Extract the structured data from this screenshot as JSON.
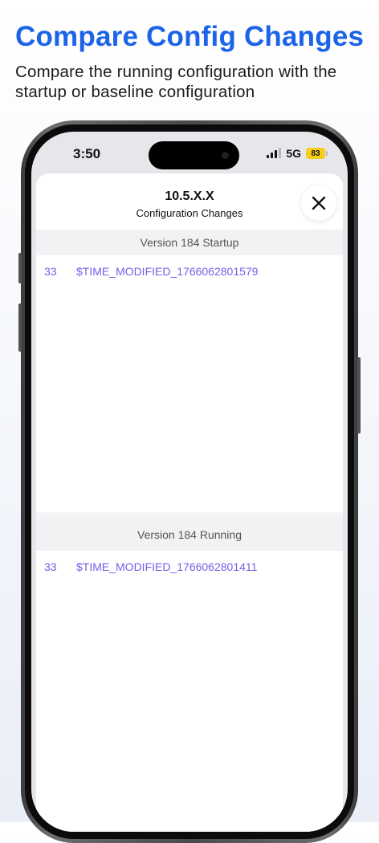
{
  "promo": {
    "title": "Compare Config Changes",
    "subtitle": "Compare the running configuration with the startup or baseline configuration"
  },
  "status_bar": {
    "time": "3:50",
    "network": "5G",
    "battery": "83",
    "signal_bars_active": 3,
    "signal_bars_total": 4,
    "battery_color": "#f7ce1c"
  },
  "sheet": {
    "title": "10.5.X.X",
    "subtitle": "Configuration Changes",
    "close_icon": "close-x-icon"
  },
  "panels": [
    {
      "header": "Version 184 Startup",
      "lines": [
        {
          "number": "33",
          "text": "$TIME_MODIFIED_1766062801579"
        }
      ]
    },
    {
      "header": "Version 184 Running",
      "lines": [
        {
          "number": "33",
          "text": "$TIME_MODIFIED_1766062801411"
        }
      ]
    }
  ],
  "colors": {
    "promo_title": "#1b63e8",
    "diff_text": "#7b5be8"
  }
}
